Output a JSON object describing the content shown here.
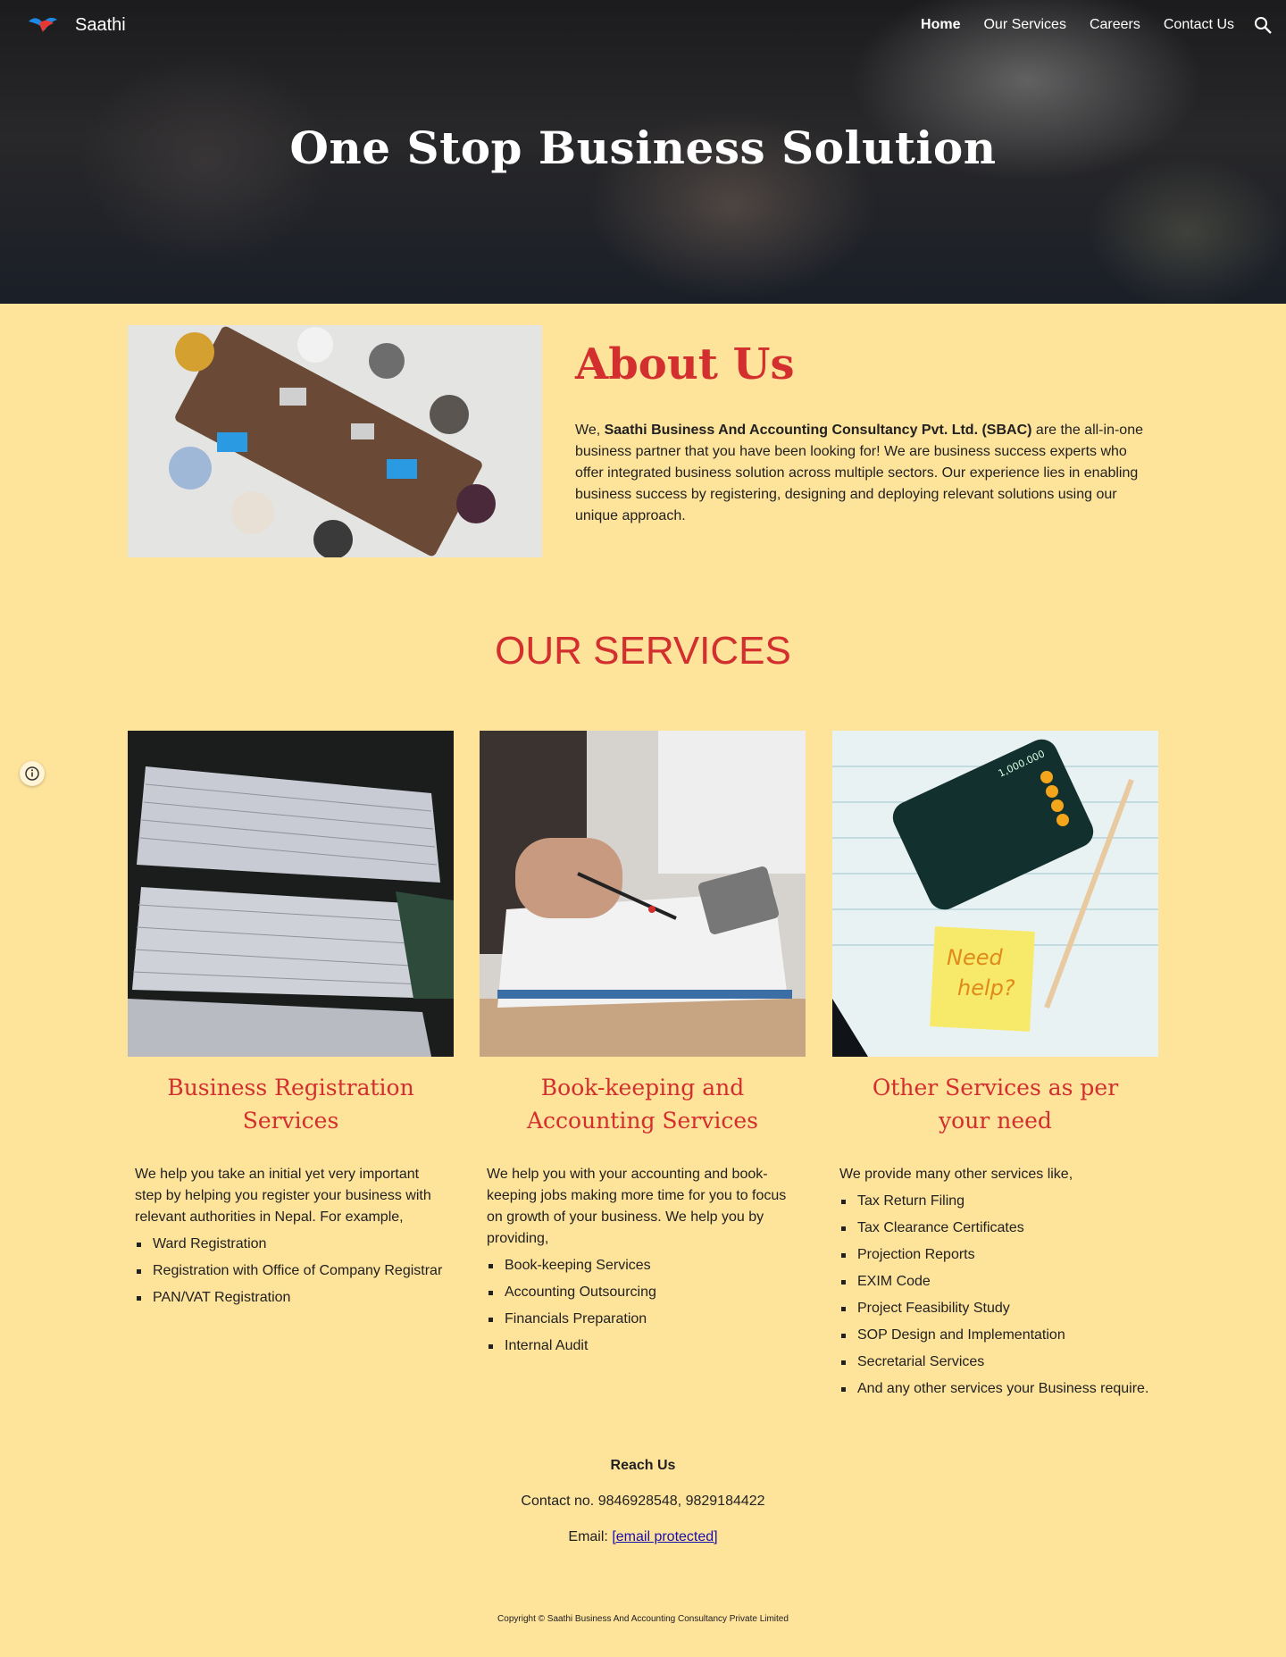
{
  "header": {
    "brand": "Saathi",
    "nav": [
      "Home",
      "Our Services",
      "Careers",
      "Contact Us"
    ],
    "active_nav": "Home",
    "search_icon": "search-icon"
  },
  "hero": {
    "title": "One Stop Business Solution"
  },
  "about": {
    "title": "About Us",
    "text_prefix": "We, ",
    "company_name": "Saathi Business And Accounting Consultancy Pvt. Ltd. (SBAC)",
    "text_suffix": " are the all-in-one business partner that you have been looking for! We are business success experts who offer integrated business solution across multiple sectors. Our experience lies in enabling business success by registering, designing and deploying relevant solutions using our unique approach."
  },
  "services": {
    "title": "OUR SERVICES",
    "cards": [
      {
        "title": "Business Registration Services",
        "desc": "We help you take an initial yet very important step by helping you register your business with relevant authorities in Nepal. For example,",
        "items": [
          "Ward Registration",
          "Registration with Office of Company Registrar",
          "PAN/VAT Registration"
        ]
      },
      {
        "title": "Book-keeping and Accounting Services",
        "desc": "We help you with your accounting and book-keeping jobs making more time for you to focus on growth of your business. We help you by providing,",
        "items": [
          "Book-keeping Services",
          "Accounting Outsourcing",
          "Financials Preparation",
          "Internal Audit"
        ]
      },
      {
        "title": "Other Services as per your need",
        "desc": "We provide many other services like,",
        "items": [
          "Tax Return Filing",
          "Tax Clearance Certificates",
          "Projection Reports",
          "EXIM Code",
          "Project Feasibility Study",
          "SOP Design and Implementation",
          "Secretarial Services",
          "And any other services your Business require."
        ]
      }
    ]
  },
  "footer": {
    "reach": "Reach Us",
    "contact": "Contact no. 9846928548, 9829184422",
    "email_label": "Email: ",
    "email_link": "[email protected]",
    "copyright": "Copyright © Saathi Business And Accounting Consultancy Private Limited"
  },
  "sticky_note": {
    "line1": "Need",
    "line2": "help?"
  },
  "calculator_display": "1,000.000",
  "colors": {
    "background": "#fee39b",
    "accent": "#d32f2f",
    "link": "#1a0dab"
  }
}
